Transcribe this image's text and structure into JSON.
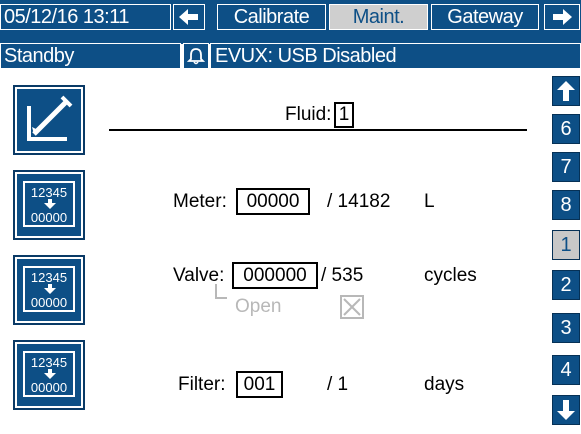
{
  "header": {
    "datetime": "05/12/16 13:11",
    "tabs": [
      {
        "label": "Calibrate",
        "active": false
      },
      {
        "label": "Maint.",
        "active": true
      },
      {
        "label": "Gateway",
        "active": false
      }
    ],
    "status": "Standby",
    "alert_text": "EVUX: USB Disabled"
  },
  "main": {
    "fluid_label": "Fluid:",
    "fluid_value": "1",
    "rows": [
      {
        "name": "meter",
        "label": "Meter:",
        "value": "00000",
        "total": "/ 14182",
        "unit": "L"
      },
      {
        "name": "valve",
        "label": "Valve:",
        "value": "000000",
        "total": "/ 535",
        "unit": "cycles"
      },
      {
        "name": "filter",
        "label": "Filter:",
        "value": "001",
        "total": "/ 1",
        "unit": "days"
      }
    ],
    "valve_open_label": "Open",
    "reset_icon_top": "12345",
    "reset_icon_bottom": "00000"
  },
  "side_nav": {
    "items": [
      "6",
      "7",
      "8",
      "1",
      "2",
      "3",
      "4"
    ],
    "selected": "1"
  },
  "colors": {
    "primary": "#0d4f86",
    "active_tab": "#cfcfcf",
    "disabled_text": "#b8b8b8"
  },
  "icons": {
    "back": "arrow-left-icon",
    "forward": "arrow-right-icon",
    "alarm": "bell-icon",
    "up": "arrow-up-icon",
    "down": "arrow-down-icon",
    "edit": "edit-icon",
    "reset": "reset-counter-icon"
  }
}
